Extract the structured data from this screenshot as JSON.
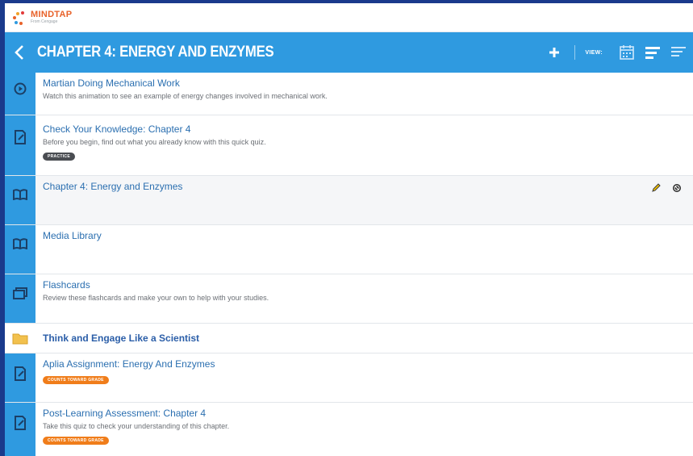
{
  "brand": {
    "name": "MINDTAP",
    "tagline": "From Cengage",
    "colors": [
      "#e8622a",
      "#f0a22a",
      "#e23a3a",
      "#2f9ae0"
    ]
  },
  "chapter_bar": {
    "title": "CHAPTER 4: ENERGY AND ENZYMES",
    "view_label": "VIEW:",
    "accent": "#2f9ae0"
  },
  "items": [
    {
      "icon": "play-circle-icon",
      "title": "Martian Doing Mechanical Work",
      "description": "Watch this animation to see an example of energy changes involved in mechanical work."
    },
    {
      "icon": "quiz-icon",
      "title": "Check Your Knowledge: Chapter 4",
      "description": "Before you begin, find out what you already know with this quick quiz.",
      "badge": "PRACTICE"
    },
    {
      "icon": "book-icon",
      "title": "Chapter 4: Energy and Enzymes"
    },
    {
      "icon": "book-icon",
      "title": "Media Library"
    },
    {
      "icon": "flashcards-icon",
      "title": "Flashcards",
      "description": "Review these flashcards and make your own to help with your studies."
    },
    {
      "icon": "folder-icon",
      "section_title": "Think and Engage Like a Scientist"
    },
    {
      "icon": "quiz-icon",
      "title": "Aplia Assignment: Energy And Enzymes",
      "badge": "COUNTS TOWARD GRADE"
    },
    {
      "icon": "quiz-icon",
      "title": "Post-Learning Assessment: Chapter 4",
      "description": "Take this quiz to check your understanding of this chapter.",
      "badge": "COUNTS TOWARD GRADE"
    }
  ]
}
